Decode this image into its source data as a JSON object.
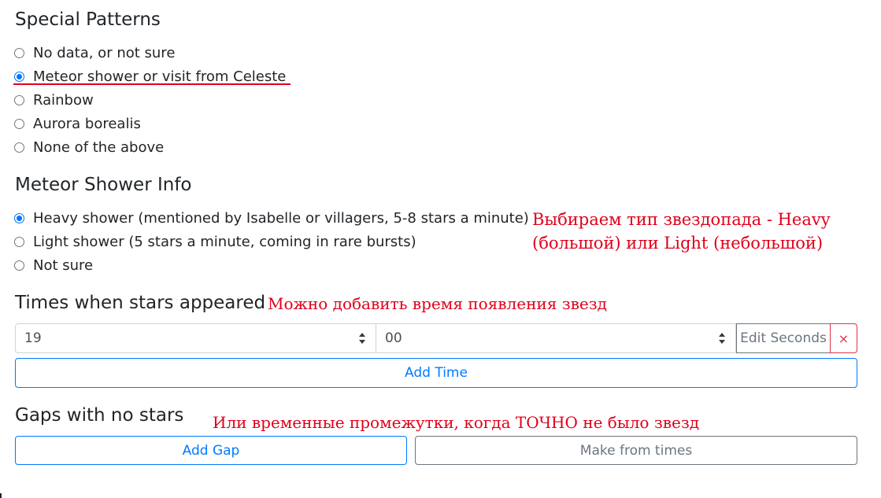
{
  "special_patterns": {
    "title": "Special Patterns",
    "options": [
      {
        "label": "No data, or not sure",
        "checked": false
      },
      {
        "label": "Meteor shower or visit from Celeste",
        "checked": true
      },
      {
        "label": "Rainbow",
        "checked": false
      },
      {
        "label": "Aurora borealis",
        "checked": false
      },
      {
        "label": "None of the above",
        "checked": false
      }
    ]
  },
  "meteor_info": {
    "title": "Meteor Shower Info",
    "options": [
      {
        "label": "Heavy shower (mentioned by Isabelle or villagers, 5-8 stars a minute)",
        "checked": true
      },
      {
        "label": "Light shower (5 stars a minute, coming in rare bursts)",
        "checked": false
      },
      {
        "label": "Not sure",
        "checked": false
      }
    ],
    "note_line1": "Выбираем тип звездопада - Heavy",
    "note_line2": "(большой) или Light (небольшой)"
  },
  "times": {
    "title": "Times when stars appeared",
    "note": "Можно добавить время появления звезд",
    "hour_value": "19",
    "minute_value": "00",
    "edit_seconds_label": "Edit Seconds",
    "remove_label": "×",
    "add_time_label": "Add Time"
  },
  "gaps": {
    "title": "Gaps with no stars",
    "note": "Или временные промежутки, когда ТОЧНО не было звезд",
    "add_gap_label": "Add Gap",
    "make_from_times_label": "Make from times"
  },
  "colors": {
    "primary": "#007bff",
    "secondary": "#6c757d",
    "danger": "#dc3545",
    "annotation": "#e0001a",
    "radio_checked": "#0075ff"
  }
}
